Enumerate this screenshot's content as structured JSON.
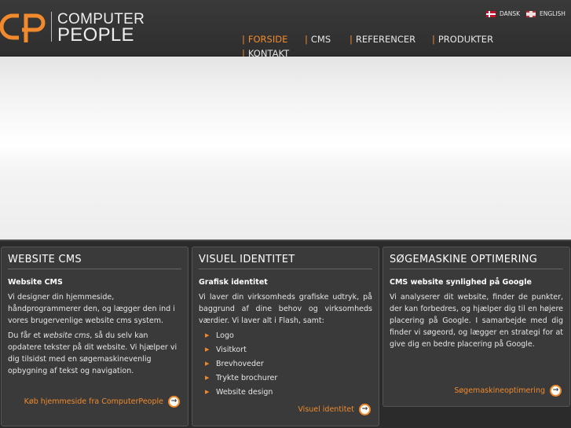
{
  "brand": {
    "line1": "COMPUTER",
    "line2": "PEOPLE",
    "accent_color": "#f08a2c"
  },
  "languages": [
    {
      "label": "DANSK",
      "flag": "denmark-flag-icon"
    },
    {
      "label": "ENGLISH",
      "flag": "uk-flag-icon"
    }
  ],
  "nav": {
    "separator": "|",
    "items": [
      {
        "label": "FORSIDE",
        "active": true
      },
      {
        "label": "CMS"
      },
      {
        "label": "REFERENCER"
      },
      {
        "label": "PRODUKTER"
      },
      {
        "label": "KONTAKT"
      }
    ]
  },
  "cards": [
    {
      "title": "WEBSITE CMS",
      "subtitle": "Website CMS",
      "p1": "Vi designer din hjemmeside, håndprogrammerer den, og lægger den ind i vores brugervenlige website cms system.",
      "p2_pre": "Du får et ",
      "p2_em": "website cms",
      "p2_post": ", så du selv kan opdatere tekster på dit website. Vi hjælper vi dig tilsidst med en søgemaskinevenlig opbygning af tekst og navigation.",
      "link": "Køb hjemmeside fra ComputerPeople"
    },
    {
      "title": "VISUEL IDENTITET",
      "subtitle": "Grafisk identitet",
      "p1": "Vi laver din virksomheds grafiske udtryk, på baggrund af dine behov og virksomheds værdier. Vi laver alt i Flash, samt:",
      "bullets": [
        "Logo",
        "Visitkort",
        "Brevhoveder",
        "Trykte brochurer",
        "Website design"
      ],
      "link": "Visuel identitet"
    },
    {
      "title": "SØGEMASKINE OPTIMERING",
      "subtitle": "CMS website synlighed på Google",
      "p1": "Vi analyserer dit website, finder de punkter, der kan forbedres, og hjælper dig til en højere placering på Google. I samarbejde med dig finder vi søgeord, og lægger en strategi for at give dig en bedre placering på Google.",
      "link": "Søgemaskineoptimering"
    }
  ]
}
